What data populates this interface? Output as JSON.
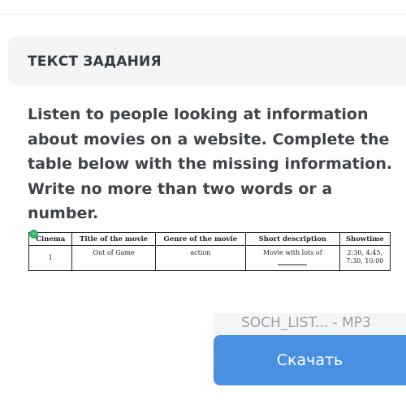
{
  "header": {
    "title": "ТЕКСТ ЗАДАНИЯ"
  },
  "task": {
    "lines": [
      "Listen to people looking at information",
      "about movies on a website. Complete the",
      "table below with the missing information.",
      "Write no more than two words or a",
      "number."
    ]
  },
  "table": {
    "headers": [
      "Cinema",
      "Title of the movie",
      "Genre of the movie",
      "Short description",
      "Showtime"
    ],
    "rows": [
      [
        "1",
        "Out of Game",
        "action",
        "Movie with lots of",
        "2:30, 4:45,\n7:30, 10:00"
      ]
    ]
  },
  "file": {
    "name": "SOCH_LIST... - MP3"
  },
  "download": {
    "label": "Скачать"
  },
  "colors": {
    "accent": "#4a90e2",
    "header_bg": "#f3f4f6",
    "text": "#3f4449"
  }
}
